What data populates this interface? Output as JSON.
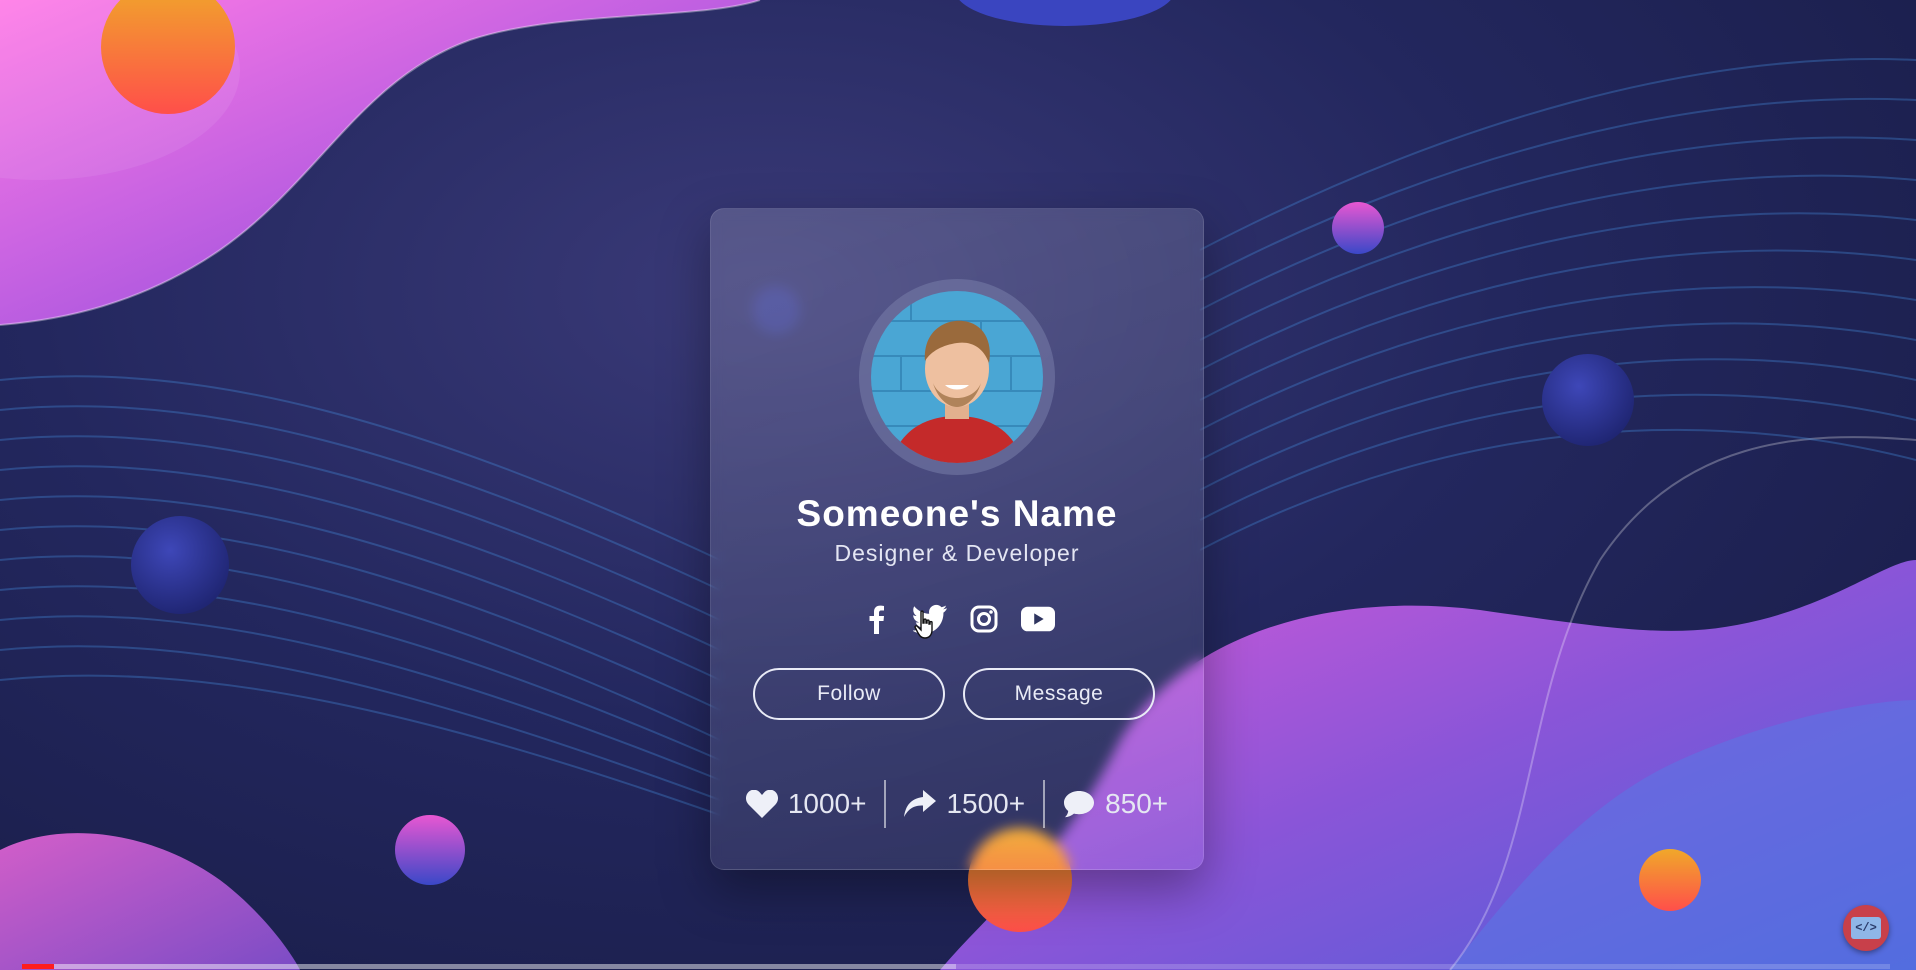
{
  "profile": {
    "name": "Someone's Name",
    "role": "Designer & Developer"
  },
  "socials": [
    {
      "icon": "facebook-icon"
    },
    {
      "icon": "twitter-icon"
    },
    {
      "icon": "instagram-icon"
    },
    {
      "icon": "youtube-icon"
    }
  ],
  "actions": {
    "follow_label": "Follow",
    "message_label": "Message"
  },
  "stats": {
    "likes": "1000+",
    "shares": "1500+",
    "comments": "850+"
  },
  "player": {
    "played_fraction": 0.017,
    "buffered_fraction": 0.5
  },
  "badge": {
    "code_label": "</>"
  },
  "colors": {
    "accent_pink": "#e25ad8",
    "accent_orange": "#f08a2a",
    "card_text": "#ffffff",
    "progress_played": "#ff1e1e"
  }
}
